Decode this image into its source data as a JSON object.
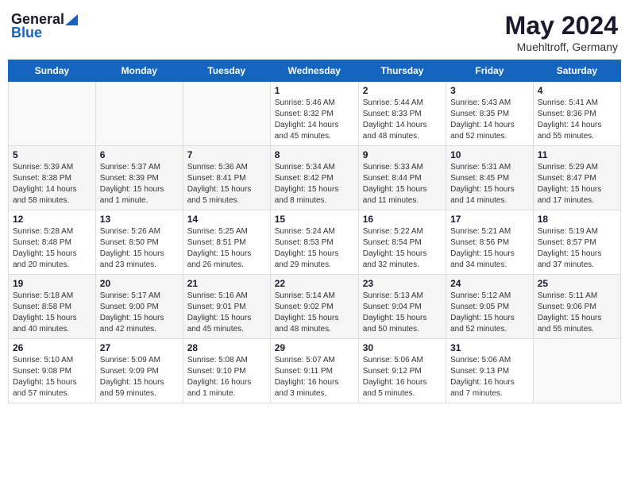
{
  "header": {
    "logo_general": "General",
    "logo_blue": "Blue",
    "month": "May 2024",
    "location": "Muehltroff, Germany"
  },
  "days_of_week": [
    "Sunday",
    "Monday",
    "Tuesday",
    "Wednesday",
    "Thursday",
    "Friday",
    "Saturday"
  ],
  "weeks": [
    [
      {
        "day": "",
        "info": ""
      },
      {
        "day": "",
        "info": ""
      },
      {
        "day": "",
        "info": ""
      },
      {
        "day": "1",
        "info": "Sunrise: 5:46 AM\nSunset: 8:32 PM\nDaylight: 14 hours\nand 45 minutes."
      },
      {
        "day": "2",
        "info": "Sunrise: 5:44 AM\nSunset: 8:33 PM\nDaylight: 14 hours\nand 48 minutes."
      },
      {
        "day": "3",
        "info": "Sunrise: 5:43 AM\nSunset: 8:35 PM\nDaylight: 14 hours\nand 52 minutes."
      },
      {
        "day": "4",
        "info": "Sunrise: 5:41 AM\nSunset: 8:36 PM\nDaylight: 14 hours\nand 55 minutes."
      }
    ],
    [
      {
        "day": "5",
        "info": "Sunrise: 5:39 AM\nSunset: 8:38 PM\nDaylight: 14 hours\nand 58 minutes."
      },
      {
        "day": "6",
        "info": "Sunrise: 5:37 AM\nSunset: 8:39 PM\nDaylight: 15 hours\nand 1 minute."
      },
      {
        "day": "7",
        "info": "Sunrise: 5:36 AM\nSunset: 8:41 PM\nDaylight: 15 hours\nand 5 minutes."
      },
      {
        "day": "8",
        "info": "Sunrise: 5:34 AM\nSunset: 8:42 PM\nDaylight: 15 hours\nand 8 minutes."
      },
      {
        "day": "9",
        "info": "Sunrise: 5:33 AM\nSunset: 8:44 PM\nDaylight: 15 hours\nand 11 minutes."
      },
      {
        "day": "10",
        "info": "Sunrise: 5:31 AM\nSunset: 8:45 PM\nDaylight: 15 hours\nand 14 minutes."
      },
      {
        "day": "11",
        "info": "Sunrise: 5:29 AM\nSunset: 8:47 PM\nDaylight: 15 hours\nand 17 minutes."
      }
    ],
    [
      {
        "day": "12",
        "info": "Sunrise: 5:28 AM\nSunset: 8:48 PM\nDaylight: 15 hours\nand 20 minutes."
      },
      {
        "day": "13",
        "info": "Sunrise: 5:26 AM\nSunset: 8:50 PM\nDaylight: 15 hours\nand 23 minutes."
      },
      {
        "day": "14",
        "info": "Sunrise: 5:25 AM\nSunset: 8:51 PM\nDaylight: 15 hours\nand 26 minutes."
      },
      {
        "day": "15",
        "info": "Sunrise: 5:24 AM\nSunset: 8:53 PM\nDaylight: 15 hours\nand 29 minutes."
      },
      {
        "day": "16",
        "info": "Sunrise: 5:22 AM\nSunset: 8:54 PM\nDaylight: 15 hours\nand 32 minutes."
      },
      {
        "day": "17",
        "info": "Sunrise: 5:21 AM\nSunset: 8:56 PM\nDaylight: 15 hours\nand 34 minutes."
      },
      {
        "day": "18",
        "info": "Sunrise: 5:19 AM\nSunset: 8:57 PM\nDaylight: 15 hours\nand 37 minutes."
      }
    ],
    [
      {
        "day": "19",
        "info": "Sunrise: 5:18 AM\nSunset: 8:58 PM\nDaylight: 15 hours\nand 40 minutes."
      },
      {
        "day": "20",
        "info": "Sunrise: 5:17 AM\nSunset: 9:00 PM\nDaylight: 15 hours\nand 42 minutes."
      },
      {
        "day": "21",
        "info": "Sunrise: 5:16 AM\nSunset: 9:01 PM\nDaylight: 15 hours\nand 45 minutes."
      },
      {
        "day": "22",
        "info": "Sunrise: 5:14 AM\nSunset: 9:02 PM\nDaylight: 15 hours\nand 48 minutes."
      },
      {
        "day": "23",
        "info": "Sunrise: 5:13 AM\nSunset: 9:04 PM\nDaylight: 15 hours\nand 50 minutes."
      },
      {
        "day": "24",
        "info": "Sunrise: 5:12 AM\nSunset: 9:05 PM\nDaylight: 15 hours\nand 52 minutes."
      },
      {
        "day": "25",
        "info": "Sunrise: 5:11 AM\nSunset: 9:06 PM\nDaylight: 15 hours\nand 55 minutes."
      }
    ],
    [
      {
        "day": "26",
        "info": "Sunrise: 5:10 AM\nSunset: 9:08 PM\nDaylight: 15 hours\nand 57 minutes."
      },
      {
        "day": "27",
        "info": "Sunrise: 5:09 AM\nSunset: 9:09 PM\nDaylight: 15 hours\nand 59 minutes."
      },
      {
        "day": "28",
        "info": "Sunrise: 5:08 AM\nSunset: 9:10 PM\nDaylight: 16 hours\nand 1 minute."
      },
      {
        "day": "29",
        "info": "Sunrise: 5:07 AM\nSunset: 9:11 PM\nDaylight: 16 hours\nand 3 minutes."
      },
      {
        "day": "30",
        "info": "Sunrise: 5:06 AM\nSunset: 9:12 PM\nDaylight: 16 hours\nand 5 minutes."
      },
      {
        "day": "31",
        "info": "Sunrise: 5:06 AM\nSunset: 9:13 PM\nDaylight: 16 hours\nand 7 minutes."
      },
      {
        "day": "",
        "info": ""
      }
    ]
  ]
}
